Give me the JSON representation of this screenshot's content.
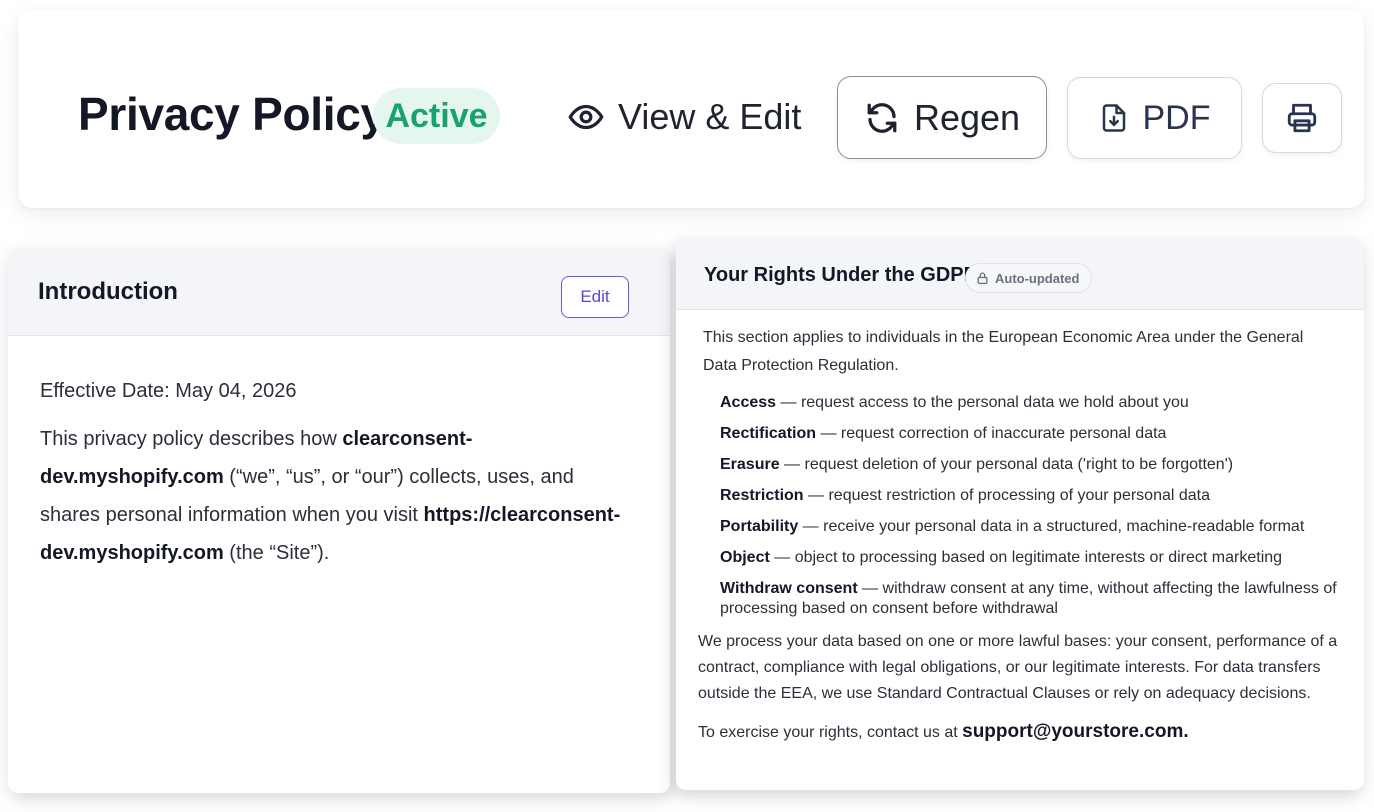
{
  "header": {
    "title": "Privacy Policy",
    "status": "Active",
    "view_edit_label": "View & Edit",
    "regen_label": "Regen",
    "pdf_label": "PDF",
    "icons": [
      "eye-icon",
      "refresh-icon",
      "file-download-icon",
      "printer-icon"
    ],
    "colors": {
      "status_bg": "#e5f6ee",
      "status_text": "#18a36a"
    }
  },
  "introduction": {
    "title": "Introduction",
    "edit_label": "Edit",
    "effective_date": "Effective Date: May 04, 2026",
    "para_before_store": "This privacy policy describes how ",
    "store_domain": "clearconsent-dev.myshopify.com",
    "para_middle": " (“we”, “us”, or “our”) collects, uses, and shares personal information when you visit ",
    "site_url": "https://clearconsent-dev.myshopify.com",
    "para_after_url": " (the “Site”).",
    "colors": {
      "edit_accent": "#5b48c9"
    }
  },
  "gdpr": {
    "title": "Your Rights Under the GDPR",
    "badge": "Auto-updated",
    "badge_icon": "lock-icon",
    "intro": "This section applies to individuals in the European Economic Area under the General Data Protection Regulation.",
    "rights": [
      {
        "term": "Access",
        "desc": " — request access to the personal data we hold about you"
      },
      {
        "term": "Rectification",
        "desc": " — request correction of inaccurate personal data"
      },
      {
        "term": "Erasure",
        "desc": " — request deletion of your personal data ('right to be forgotten')"
      },
      {
        "term": "Restriction",
        "desc": " — request restriction of processing of your personal data"
      },
      {
        "term": "Portability",
        "desc": " — receive your personal data in a structured, machine-readable format"
      },
      {
        "term": "Object",
        "desc": " — object to processing based on legitimate interests or direct marketing"
      },
      {
        "term": "Withdraw consent",
        "desc": " — withdraw consent at any time, without affecting the lawfulness of processing based on consent before withdrawal"
      }
    ],
    "lawful_bases": "We process your data based on one or more lawful bases: your consent, performance of a contract, compliance with legal obligations, or our legitimate interests. For data transfers outside the EEA, we use Standard Contractual Clauses or rely on adequacy decisions.",
    "contact_prefix": "To exercise your rights, contact us at ",
    "contact_email": "support@yourstore.com",
    "contact_suffix": "."
  }
}
